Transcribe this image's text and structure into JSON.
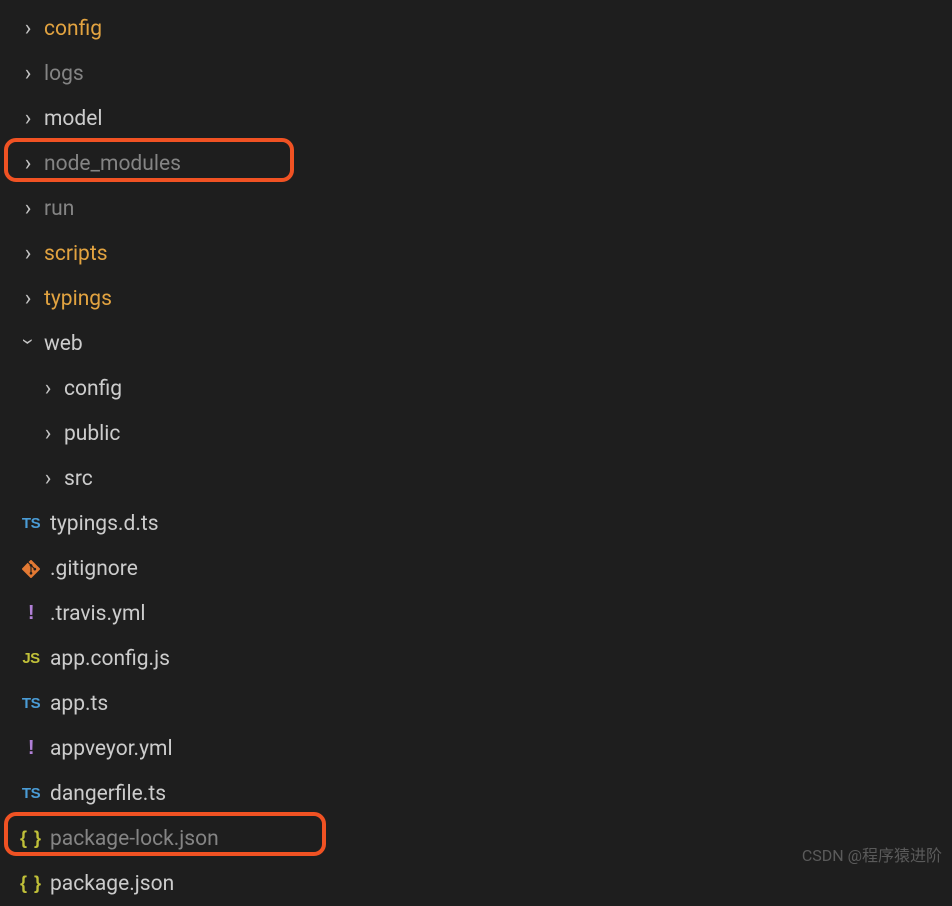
{
  "tree": {
    "config": {
      "label": "config",
      "kind": "folder",
      "expanded": false,
      "style": "orange",
      "indent": 0
    },
    "logs": {
      "label": "logs",
      "kind": "folder",
      "expanded": false,
      "style": "dim",
      "indent": 0
    },
    "model": {
      "label": "model",
      "kind": "folder",
      "expanded": false,
      "style": "normal",
      "indent": 0
    },
    "node_modules": {
      "label": "node_modules",
      "kind": "folder",
      "expanded": false,
      "style": "dim",
      "indent": 0
    },
    "run": {
      "label": "run",
      "kind": "folder",
      "expanded": false,
      "style": "dim",
      "indent": 0
    },
    "scripts": {
      "label": "scripts",
      "kind": "folder",
      "expanded": false,
      "style": "orange",
      "indent": 0
    },
    "typings": {
      "label": "typings",
      "kind": "folder",
      "expanded": false,
      "style": "orange",
      "indent": 0
    },
    "web": {
      "label": "web",
      "kind": "folder",
      "expanded": true,
      "style": "normal",
      "indent": 0
    },
    "web_config": {
      "label": "config",
      "kind": "folder",
      "expanded": false,
      "style": "normal",
      "indent": 1
    },
    "web_public": {
      "label": "public",
      "kind": "folder",
      "expanded": false,
      "style": "normal",
      "indent": 1
    },
    "web_src": {
      "label": "src",
      "kind": "folder",
      "expanded": false,
      "style": "normal",
      "indent": 1
    },
    "typings_d_ts": {
      "label": "typings.d.ts",
      "kind": "file",
      "icon": "ts",
      "style": "normal",
      "indent": 1
    },
    "gitignore": {
      "label": ".gitignore",
      "kind": "file",
      "icon": "git",
      "style": "normal",
      "indent": 0
    },
    "travis_yml": {
      "label": ".travis.yml",
      "kind": "file",
      "icon": "ex",
      "style": "normal",
      "indent": 0
    },
    "app_config_js": {
      "label": "app.config.js",
      "kind": "file",
      "icon": "js",
      "style": "normal",
      "indent": 0
    },
    "app_ts": {
      "label": "app.ts",
      "kind": "file",
      "icon": "ts",
      "style": "normal",
      "indent": 0
    },
    "appveyor_yml": {
      "label": "appveyor.yml",
      "kind": "file",
      "icon": "ex",
      "style": "normal",
      "indent": 0
    },
    "dangerfile_ts": {
      "label": "dangerfile.ts",
      "kind": "file",
      "icon": "ts",
      "style": "normal",
      "indent": 0
    },
    "package_lock_json": {
      "label": "package-lock.json",
      "kind": "file",
      "icon": "json",
      "style": "dim",
      "indent": 0
    },
    "package_json": {
      "label": "package.json",
      "kind": "file",
      "icon": "json",
      "style": "normal",
      "indent": 0
    }
  },
  "icons": {
    "ts": "TS",
    "js": "JS",
    "ex": "!",
    "json": "{ }"
  },
  "watermark": "CSDN @程序猿进阶"
}
